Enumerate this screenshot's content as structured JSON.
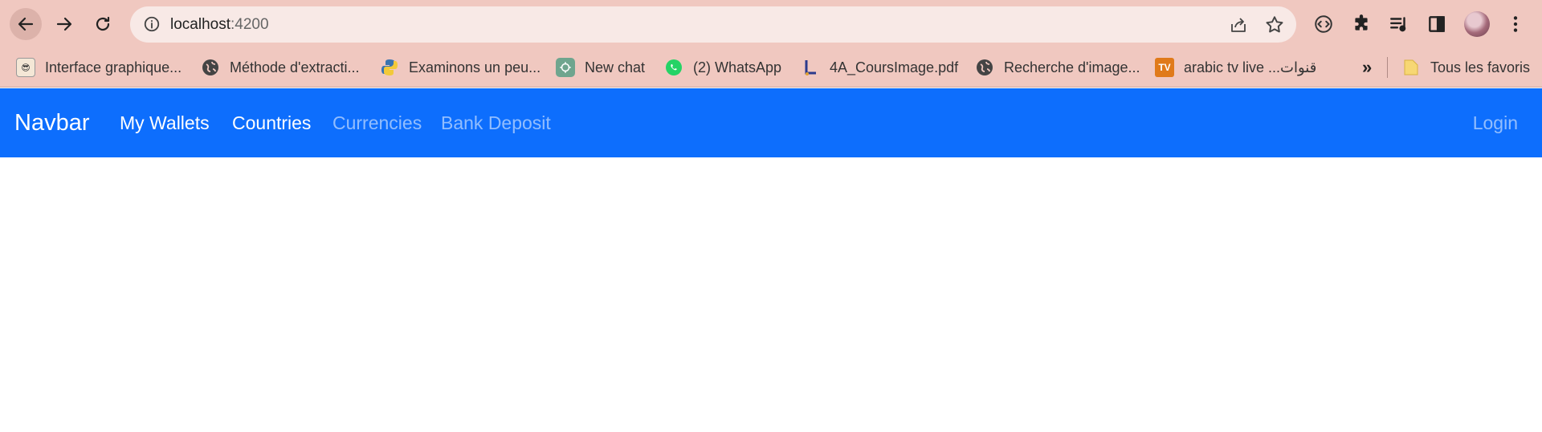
{
  "browser": {
    "url_host": "localhost",
    "url_port": ":4200",
    "bookmarks": [
      {
        "label": "Interface graphique...",
        "icon": "avatar-favicon"
      },
      {
        "label": "Méthode d'extracti...",
        "icon": "globe-icon"
      },
      {
        "label": "Examinons un peu...",
        "icon": "python-icon"
      },
      {
        "label": "New chat",
        "icon": "chatgpt-icon"
      },
      {
        "label": "(2) WhatsApp",
        "icon": "whatsapp-icon"
      },
      {
        "label": "4A_CoursImage.pdf",
        "icon": "pdf-icon"
      },
      {
        "label": "Recherche d'image...",
        "icon": "globe-icon"
      },
      {
        "label": "arabic tv live ...قنوات",
        "icon": "tv-icon"
      }
    ],
    "more_bookmarks": "»",
    "all_bookmarks": "Tous les favoris"
  },
  "navbar": {
    "brand": "Navbar",
    "links": [
      {
        "label": "My Wallets",
        "active": true
      },
      {
        "label": "Countries",
        "active": true
      },
      {
        "label": "Currencies",
        "active": false
      },
      {
        "label": "Bank Deposit",
        "active": false
      }
    ],
    "login": "Login"
  },
  "colors": {
    "chrome": "#f0c8c0",
    "navbar": "#0d6efd"
  }
}
